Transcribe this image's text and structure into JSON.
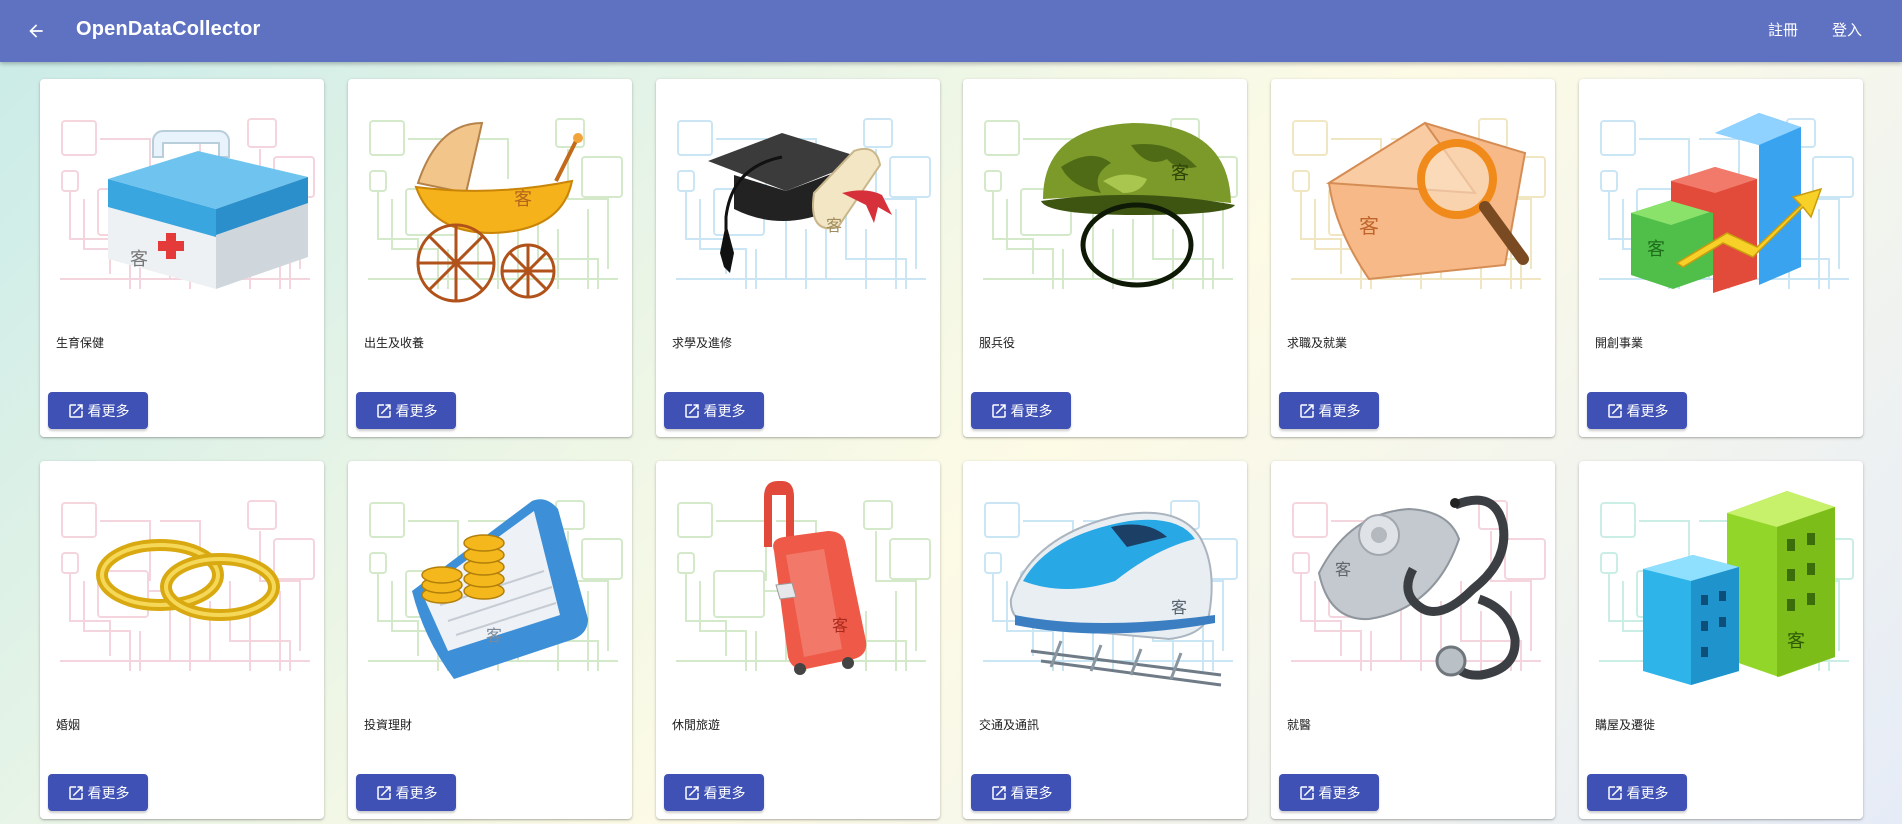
{
  "app": {
    "title": "OpenDataCollector",
    "register_label": "註冊",
    "login_label": "登入"
  },
  "more_label": "看更多",
  "cards": [
    {
      "title": "生育保健",
      "icon": "first-aid-kit-icon",
      "theme": "#e8a3b4"
    },
    {
      "title": "出生及收養",
      "icon": "baby-stroller-icon",
      "theme": "#9fd08a"
    },
    {
      "title": "求學及進修",
      "icon": "graduation-cap-icon",
      "theme": "#8cc6e6"
    },
    {
      "title": "服兵役",
      "icon": "military-helmet-icon",
      "theme": "#9fd08a"
    },
    {
      "title": "求職及就業",
      "icon": "job-search-icon",
      "theme": "#e0c97a"
    },
    {
      "title": "開創事業",
      "icon": "growth-chart-icon",
      "theme": "#8cc6e6"
    },
    {
      "title": "婚姻",
      "icon": "wedding-rings-icon",
      "theme": "#e8a3b4"
    },
    {
      "title": "投資理財",
      "icon": "investment-coins-icon",
      "theme": "#9fd08a"
    },
    {
      "title": "休閒旅遊",
      "icon": "suitcase-icon",
      "theme": "#9fd08a"
    },
    {
      "title": "交通及通訊",
      "icon": "bullet-train-icon",
      "theme": "#8cc6e6"
    },
    {
      "title": "就醫",
      "icon": "stethoscope-icon",
      "theme": "#e8a3b4"
    },
    {
      "title": "購屋及遷徙",
      "icon": "buildings-icon",
      "theme": "#8cd9c6"
    }
  ]
}
